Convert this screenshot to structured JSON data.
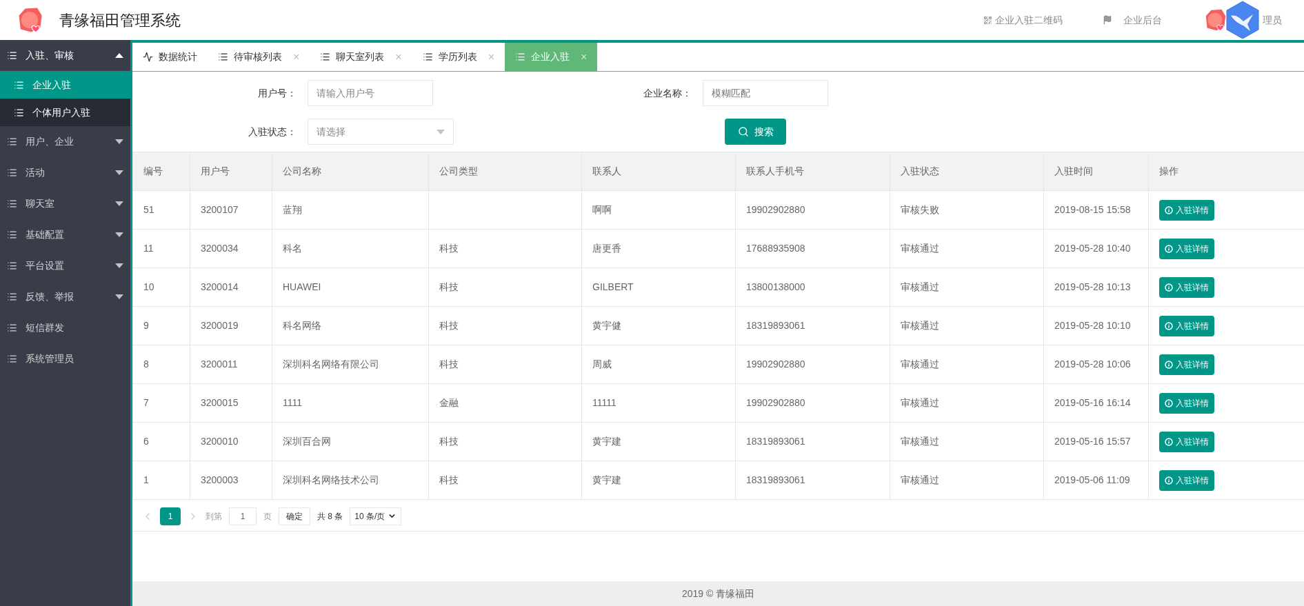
{
  "header": {
    "title": "青缘福田管理系统",
    "links": [
      {
        "kind": "qrcode",
        "label": "企业入驻二维码"
      },
      {
        "kind": "flag",
        "label": "企业后台"
      }
    ],
    "user": "理员"
  },
  "sidebar": {
    "items": [
      {
        "label": "入驻、审核",
        "kind": "group",
        "expanded": true,
        "children": [
          {
            "label": "企业入驻",
            "selected": true
          },
          {
            "label": "个体用户入驻",
            "selected": false
          }
        ]
      },
      {
        "label": "用户、企业",
        "kind": "group",
        "expanded": false
      },
      {
        "label": "活动",
        "kind": "group",
        "expanded": false
      },
      {
        "label": "聊天室",
        "kind": "group",
        "expanded": false
      },
      {
        "label": "基础配置",
        "kind": "group",
        "expanded": false
      },
      {
        "label": "平台设置",
        "kind": "group",
        "expanded": false
      },
      {
        "label": "反馈、举报",
        "kind": "group",
        "expanded": false
      },
      {
        "label": "短信群发",
        "kind": "link"
      },
      {
        "label": "系统管理员",
        "kind": "link"
      }
    ]
  },
  "tabs": [
    {
      "label": "数据统计",
      "kind": "pulse",
      "closable": false,
      "selected": false
    },
    {
      "label": "待审核列表",
      "kind": "list",
      "closable": true,
      "selected": false
    },
    {
      "label": "聊天室列表",
      "kind": "list",
      "closable": true,
      "selected": false
    },
    {
      "label": "学历列表",
      "kind": "list",
      "closable": true,
      "selected": false
    },
    {
      "label": "企业入驻",
      "kind": "list",
      "closable": true,
      "selected": true
    }
  ],
  "close_glyph": "×",
  "filters": {
    "user_no": {
      "label": "用户号：",
      "placeholder": "请输入用户号"
    },
    "company": {
      "label": "企业名称：",
      "placeholder": "模糊匹配"
    },
    "status": {
      "label": "入驻状态：",
      "placeholder": "请选择"
    },
    "search_button": "搜索"
  },
  "table": {
    "columns": [
      "编号",
      "用户号",
      "公司名称",
      "公司类型",
      "联系人",
      "联系人手机号",
      "入驻状态",
      "入驻时间",
      "操作"
    ],
    "rows": [
      {
        "cells": [
          "51",
          "3200107",
          "蓝翔",
          "",
          "啊啊",
          "19902902880",
          "审核失败",
          "2019-08-15 15:58"
        ],
        "action": "入驻详情"
      },
      {
        "cells": [
          "11",
          "3200034",
          "科名",
          "科技",
          "唐更香",
          "17688935908",
          "审核通过",
          "2019-05-28 10:40"
        ],
        "action": "入驻详情"
      },
      {
        "cells": [
          "10",
          "3200014",
          "HUAWEI",
          "科技",
          "GILBERT",
          "13800138000",
          "审核通过",
          "2019-05-28 10:13"
        ],
        "action": "入驻详情"
      },
      {
        "cells": [
          "9",
          "3200019",
          "科名网络",
          "科技",
          "黄宇健",
          "18319893061",
          "审核通过",
          "2019-05-28 10:10"
        ],
        "action": "入驻详情"
      },
      {
        "cells": [
          "8",
          "3200011",
          "深圳科名网络有限公司",
          "科技",
          "周威",
          "19902902880",
          "审核通过",
          "2019-05-28 10:06"
        ],
        "action": "入驻详情"
      },
      {
        "cells": [
          "7",
          "3200015",
          "1111",
          "金融",
          "11111",
          "19902902880",
          "审核通过",
          "2019-05-16 16:14"
        ],
        "action": "入驻详情"
      },
      {
        "cells": [
          "6",
          "3200010",
          "深圳百合网",
          "科技",
          "黄宇建",
          "18319893061",
          "审核通过",
          "2019-05-16 15:57"
        ],
        "action": "入驻详情"
      },
      {
        "cells": [
          "1",
          "3200003",
          "深圳科名网络技术公司",
          "科技",
          "黄宇建",
          "18319893061",
          "审核通过",
          "2019-05-06 11:09"
        ],
        "action": "入驻详情"
      }
    ]
  },
  "pagination": {
    "pages": [
      {
        "label": "1",
        "selected": true
      }
    ],
    "goto_label": "到第",
    "goto_value": "1",
    "page_unit": "页",
    "confirm": "确定",
    "total": "共 8 条",
    "page_size": "10 条/页"
  },
  "footer": "2019 © 青缘福田"
}
